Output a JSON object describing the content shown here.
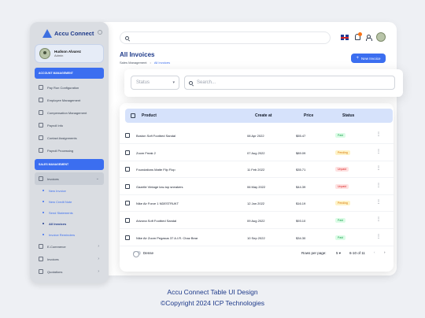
{
  "brand": {
    "name": "Accu Connect"
  },
  "user": {
    "name": "Hudson Alvarez",
    "role": "Admin"
  },
  "sidebar": {
    "account_section": "ACCOUNT MANAGEMENT",
    "account_items": [
      {
        "label": "Pay Run Configuration"
      },
      {
        "label": "Employee Management"
      },
      {
        "label": "Compensation Management"
      },
      {
        "label": "Payroll Info"
      },
      {
        "label": "Contact Assignments"
      },
      {
        "label": "Payroll Processing"
      }
    ],
    "sales_section": "SALES MANAGEMENT",
    "invoices_label": "Invoices",
    "sub_items": [
      {
        "label": "New Invoice"
      },
      {
        "label": "New Credit Note"
      },
      {
        "label": "Send Statements"
      },
      {
        "label": "All Invoices"
      },
      {
        "label": "Invoice Reminders"
      }
    ],
    "bottom_items": [
      {
        "label": "E-Commerce"
      },
      {
        "label": "Invoices"
      },
      {
        "label": "Quotations"
      }
    ]
  },
  "page": {
    "title": "All Invoices",
    "breadcrumb": [
      "Sales Management",
      "All Invoices"
    ],
    "new_button": "New Invoice"
  },
  "filter": {
    "status_placeholder": "Status",
    "search_placeholder": "Search..."
  },
  "table": {
    "headers": {
      "product": "Product",
      "created": "Create at",
      "price": "Price",
      "status": "Status"
    },
    "rows": [
      {
        "product": "Boston Soft Footbed Sandal",
        "date": "08 Apr 2022",
        "price": "$55.47",
        "status": "Paid"
      },
      {
        "product": "Zoom Freak 2",
        "date": "07 Aug 2022",
        "price": "$89.09",
        "status": "Pending"
      },
      {
        "product": "Foundations Matte Flip Flop",
        "date": "11 Feb 2022",
        "price": "$35.71",
        "status": "Unpaid"
      },
      {
        "product": "Gazelle Vintage low-top sneakers",
        "date": "06 May 2022",
        "price": "$44.39",
        "status": "Unpaid"
      },
      {
        "product": "Nike Air Force 1 NDESTRUKT",
        "date": "12 Jan 2022",
        "price": "$16.19",
        "status": "Pending"
      },
      {
        "product": "Arizona Soft Footbed Sandal",
        "date": "09 Aug 2022",
        "price": "$93.10",
        "status": "Paid"
      },
      {
        "product": "Nike Air Zoom Pegasus 37 A.I.R. Chaz Bear",
        "date": "10 Sep 2022",
        "price": "$34.30",
        "status": "Paid"
      }
    ],
    "footer": {
      "dense_label": "Dense",
      "rows_per_page_label": "Rows per page:",
      "rows_per_page": "5",
      "range": "6-10 of 11"
    }
  },
  "status_colors": {
    "Paid": {
      "bg": "#dcfce7",
      "fg": "#16a34a"
    },
    "Pending": {
      "bg": "#fef3c7",
      "fg": "#d97706"
    },
    "Unpaid": {
      "bg": "#fee2e2",
      "fg": "#dc2626"
    }
  },
  "caption": {
    "title": "Accu Connect Table UI Design",
    "copyright": "©Copyright 2024 ICP Technologies"
  }
}
